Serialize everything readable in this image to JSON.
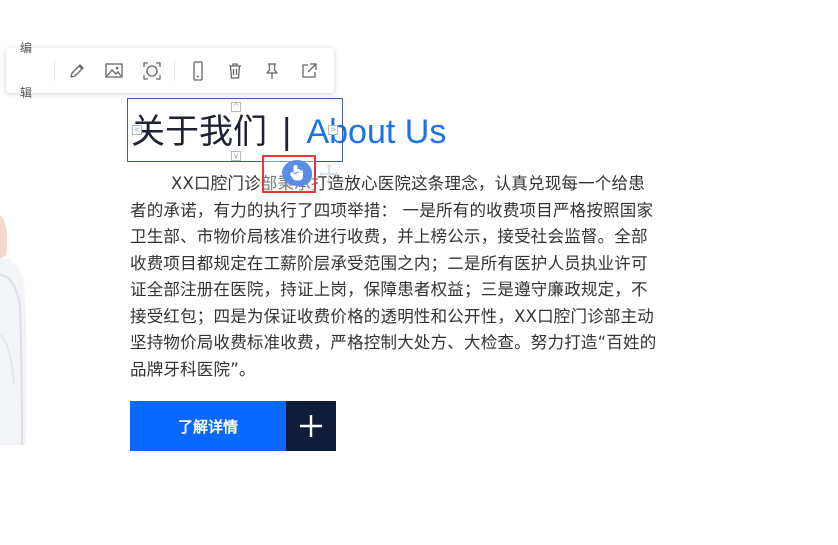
{
  "toolbar": {
    "edit_label": "编辑",
    "buttons": [
      {
        "icon": "pencil-icon"
      },
      {
        "icon": "image-icon"
      },
      {
        "icon": "scan-icon"
      },
      {
        "icon": "mobile-icon"
      },
      {
        "icon": "trash-icon"
      },
      {
        "icon": "pin-icon"
      },
      {
        "icon": "external-link-icon"
      }
    ]
  },
  "heading": {
    "cn": "关于我们",
    "separator": "|",
    "en": "About Us"
  },
  "body": {
    "text": "XX口腔门诊部秉承打造放心医院这条理念，认真兑现每一个给患者的承诺，有力的执行了四项举措： 一是所有的收费项目严格按照国家卫生部、市物价局核准价进行收费，并上榜公示，接受社会监督。全部收费项目都规定在工薪阶层承受范围之内；二是所有医护人员执业许可证全部注册在医院，持证上岗，保障患者权益；三是遵守廉政规定，不接受红包；四是为保证收费价格的透明性和公开性，XX口腔门诊部主动坚持物价局收费标准收费，严格控制大处方、大检查。努力打造“百姓的品牌牙科医院”。"
  },
  "cta": {
    "label": "了解详情",
    "plus_icon": "plus-icon"
  },
  "colors": {
    "accent_blue": "#0a68ff",
    "heading_en": "#1a73e8",
    "dark_navy": "#0f1d3a",
    "highlight_red": "#e53935"
  }
}
